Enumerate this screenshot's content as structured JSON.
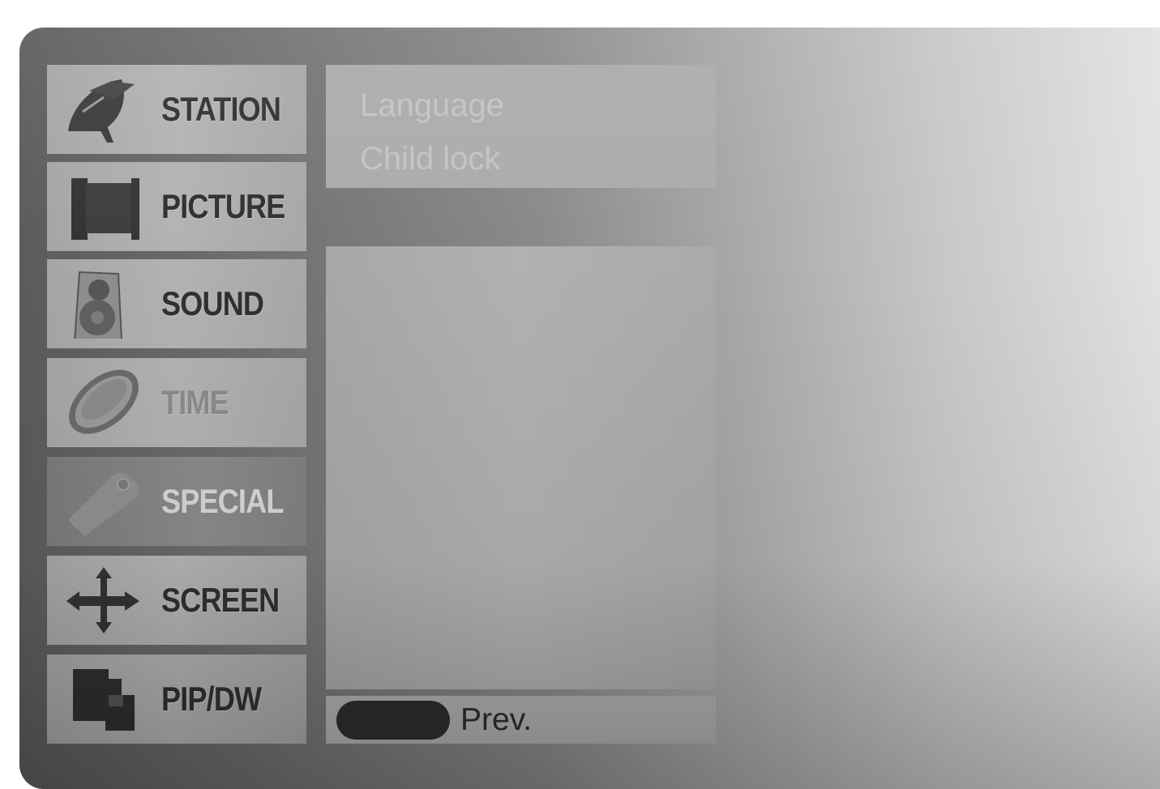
{
  "menu": {
    "items": [
      {
        "label": "STATION",
        "icon": "satellite-dish-icon",
        "state": "normal"
      },
      {
        "label": "PICTURE",
        "icon": "picture-frame-icon",
        "state": "normal"
      },
      {
        "label": "SOUND",
        "icon": "speaker-icon",
        "state": "normal"
      },
      {
        "label": "TIME",
        "icon": "clock-icon",
        "state": "dim"
      },
      {
        "label": "SPECIAL",
        "icon": "tag-icon",
        "state": "selected"
      },
      {
        "label": "SCREEN",
        "icon": "move-arrows-icon",
        "state": "normal"
      },
      {
        "label": "PIP/DW",
        "icon": "pip-icon",
        "state": "normal"
      }
    ]
  },
  "submenu": {
    "options": [
      "Language",
      "Child lock"
    ]
  },
  "footer": {
    "prev_label": "Prev."
  },
  "colors": {
    "menu_item_bg": "#b0b0b0",
    "menu_selected_bg": "#858585",
    "label_dark": "#303030",
    "label_selected": "#d6d6d6",
    "submenu_text": "#c3c3c3",
    "button_dark": "#2e2e2e"
  }
}
